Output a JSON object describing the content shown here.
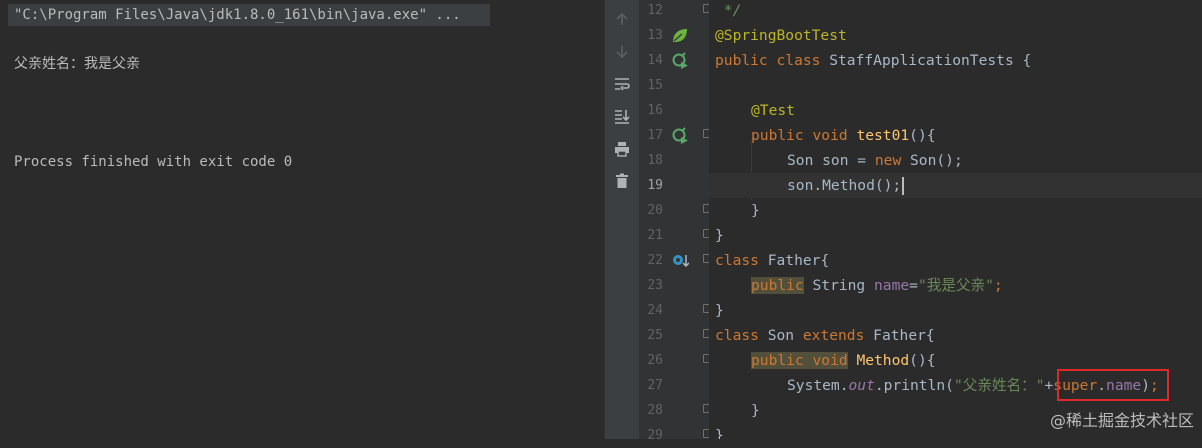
{
  "console": {
    "command": "\"C:\\Program Files\\Java\\jdk1.8.0_161\\bin\\java.exe\" ...",
    "output_line": "父亲姓名：我是父亲",
    "exit_line": "Process finished with exit code 0"
  },
  "toolbar": {
    "icons": [
      "arrow-up-icon",
      "arrow-down-icon",
      "soft-wrap-icon",
      "scroll-to-end-icon",
      "print-icon",
      "trash-icon"
    ]
  },
  "editor": {
    "line_numbers": [
      "12",
      "13",
      "14",
      "15",
      "16",
      "17",
      "18",
      "19",
      "20",
      "21",
      "22",
      "23",
      "24",
      "25",
      "26",
      "27",
      "28",
      "29"
    ],
    "current_line": "19",
    "code": {
      "l12": " */",
      "l13_ann": "@SpringBootTest",
      "l14_kw": "public class",
      "l14_rest": " StaffApplicationTests {",
      "l16_ann": "@Test",
      "l17_kw": "public void",
      "l17_fn": "test01",
      "l17_rest": "(){",
      "l18_a": "Son son = ",
      "l18_kw": "new",
      "l18_b": " Son();",
      "l19": "son.Method();",
      "l20": "}",
      "l21": "}",
      "l22_kw": "class",
      "l22_rest": " Father{",
      "l23_kw": "public",
      "l23_a": " String ",
      "l23_fld": "name",
      "l23_b": "=",
      "l23_str": "\"我是父亲\"",
      "l23_semi": ";",
      "l24": "}",
      "l25_kw": "class",
      "l25_a": " Son ",
      "l25_kw2": "extends",
      "l25_b": " Father{",
      "l26_kw": "public void",
      "l26_fn": "Method",
      "l26_rest": "(){",
      "l27_a": "System.",
      "l27_out": "out",
      "l27_b": ".println(",
      "l27_str": "\"父亲姓名：\"",
      "l27_plus": "+",
      "l27_super": "super",
      "l27_dot": ".",
      "l27_name": "name",
      "l27_c": ")",
      "l27_semi": ";",
      "l28": "}",
      "l29": "}"
    }
  },
  "watermark": "@稀土掘金技术社区"
}
